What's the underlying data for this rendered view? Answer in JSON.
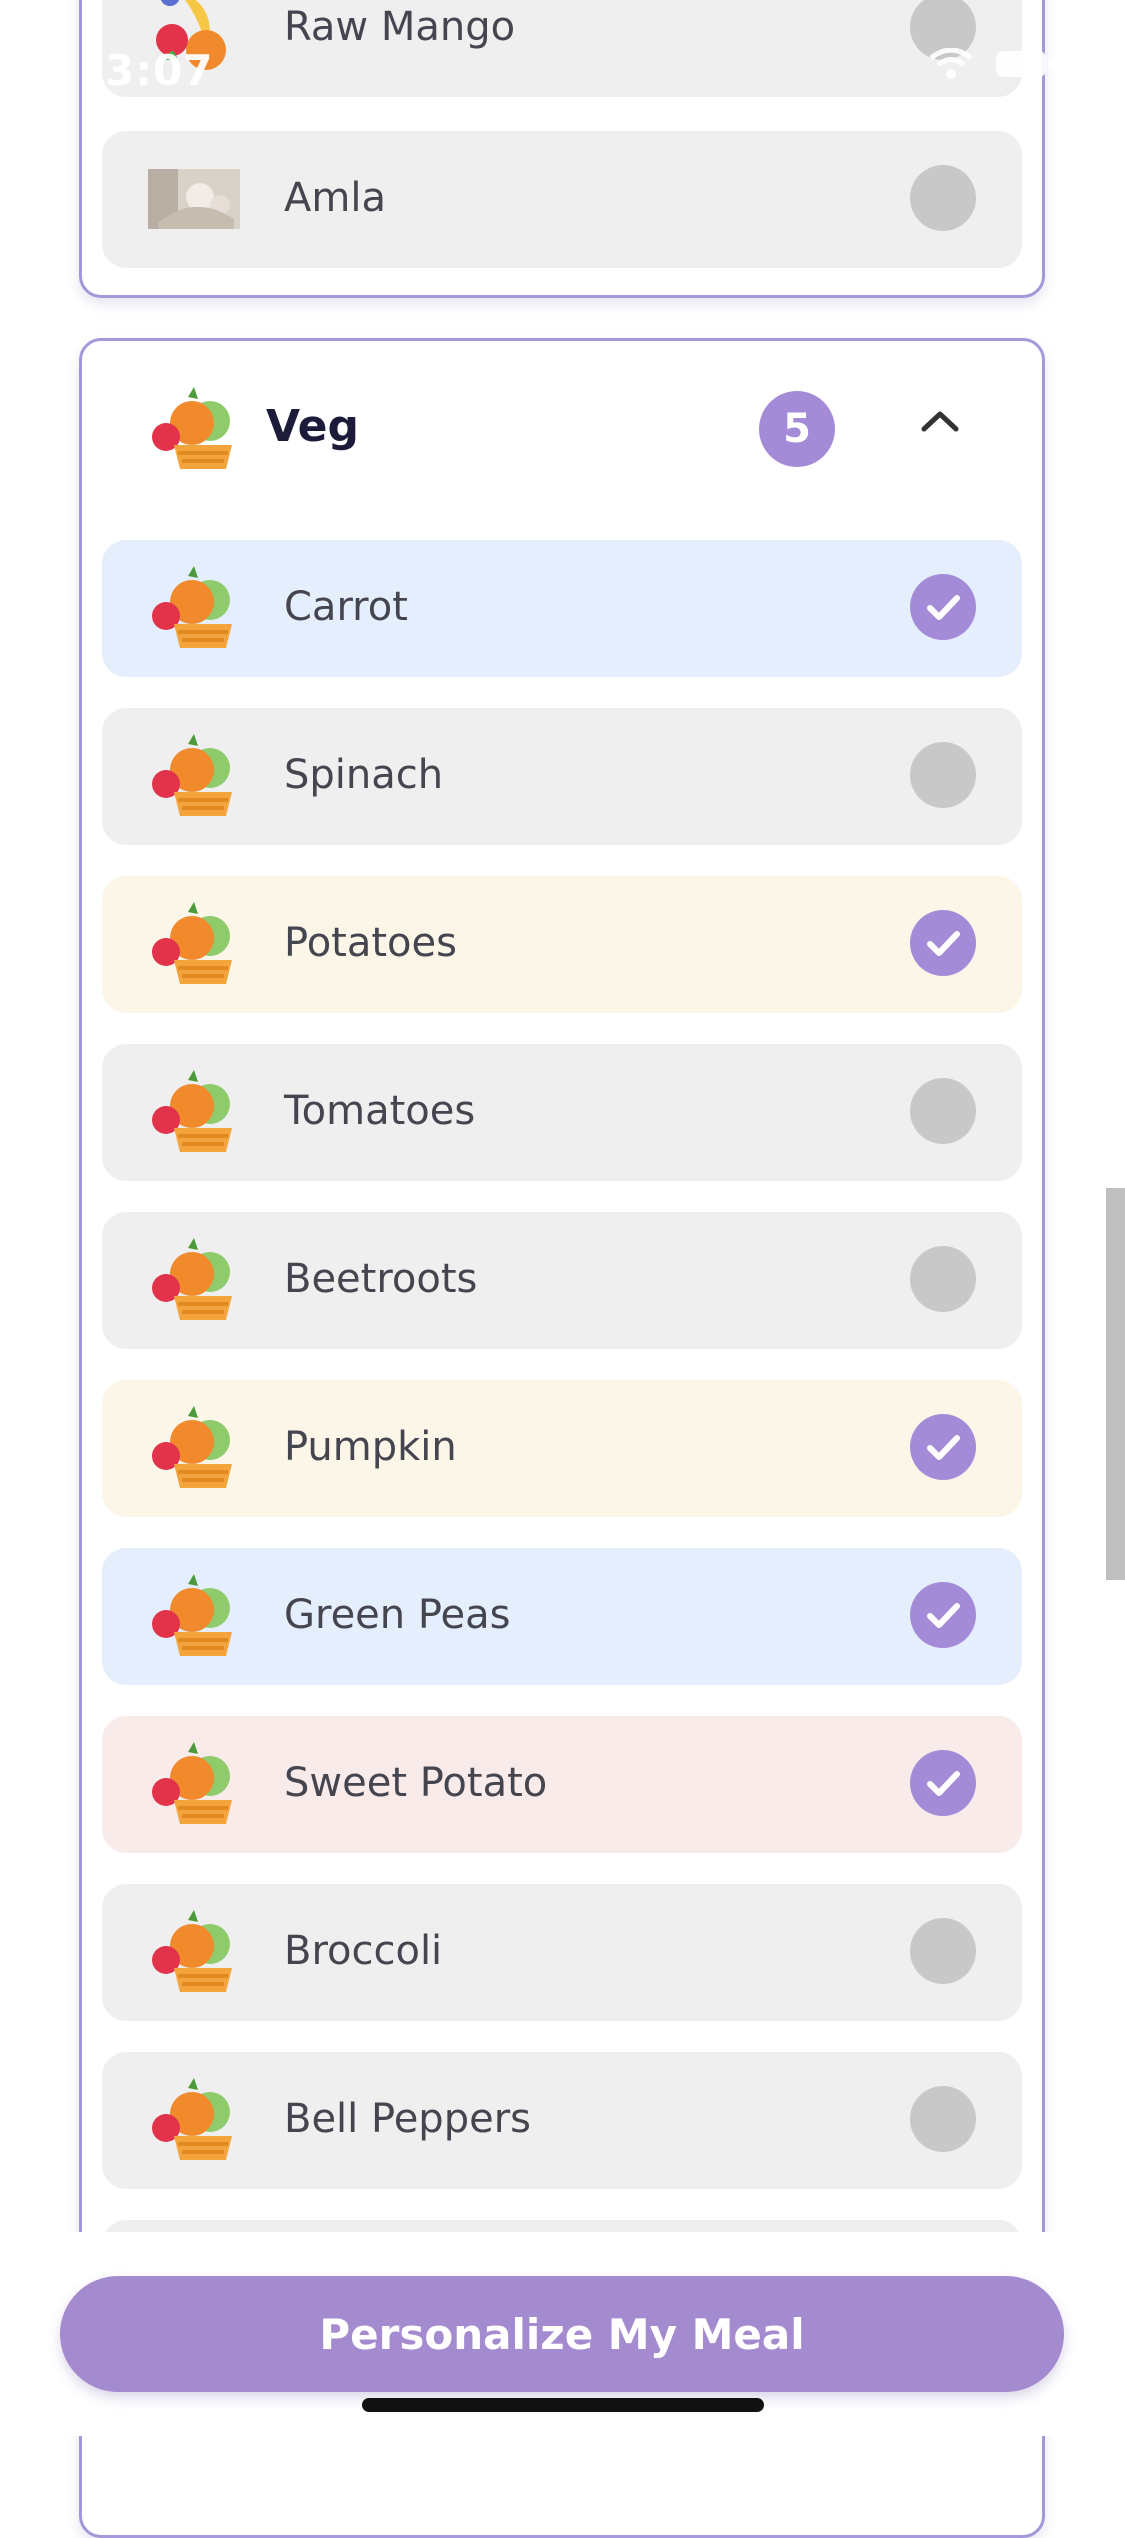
{
  "status_bar": {
    "time": "3:07",
    "wifi_icon": "wifi-icon",
    "battery_icon": "battery-icon"
  },
  "fruit_section": {
    "items": [
      {
        "label": "Raw Mango",
        "selected": false,
        "color": "grey",
        "icon": "mixed-fruits-icon"
      },
      {
        "label": "Amla",
        "selected": false,
        "color": "grey",
        "icon": "amla-photo"
      }
    ]
  },
  "veg_section": {
    "title": "Veg",
    "count": "5",
    "expanded": true,
    "icon": "vegetables-icon",
    "items": [
      {
        "label": "Carrot",
        "selected": true,
        "color": "blue"
      },
      {
        "label": "Spinach",
        "selected": false,
        "color": "grey"
      },
      {
        "label": "Potatoes",
        "selected": true,
        "color": "yellow"
      },
      {
        "label": "Tomatoes",
        "selected": false,
        "color": "grey"
      },
      {
        "label": "Beetroots",
        "selected": false,
        "color": "grey"
      },
      {
        "label": "Pumpkin",
        "selected": true,
        "color": "yellow"
      },
      {
        "label": "Green Peas",
        "selected": true,
        "color": "blue"
      },
      {
        "label": "Sweet Potato",
        "selected": true,
        "color": "pink"
      },
      {
        "label": "Broccoli",
        "selected": false,
        "color": "grey"
      },
      {
        "label": "Bell Peppers",
        "selected": false,
        "color": "grey"
      }
    ]
  },
  "cta": {
    "label": "Personalize My Meal"
  },
  "colors": {
    "accent": "#a48bd8",
    "card_border": "#a597d9",
    "item_grey": "#efefef",
    "item_blue": "#e5eefc",
    "item_yellow": "#fbf6e8",
    "item_pink": "#f9ebea"
  }
}
